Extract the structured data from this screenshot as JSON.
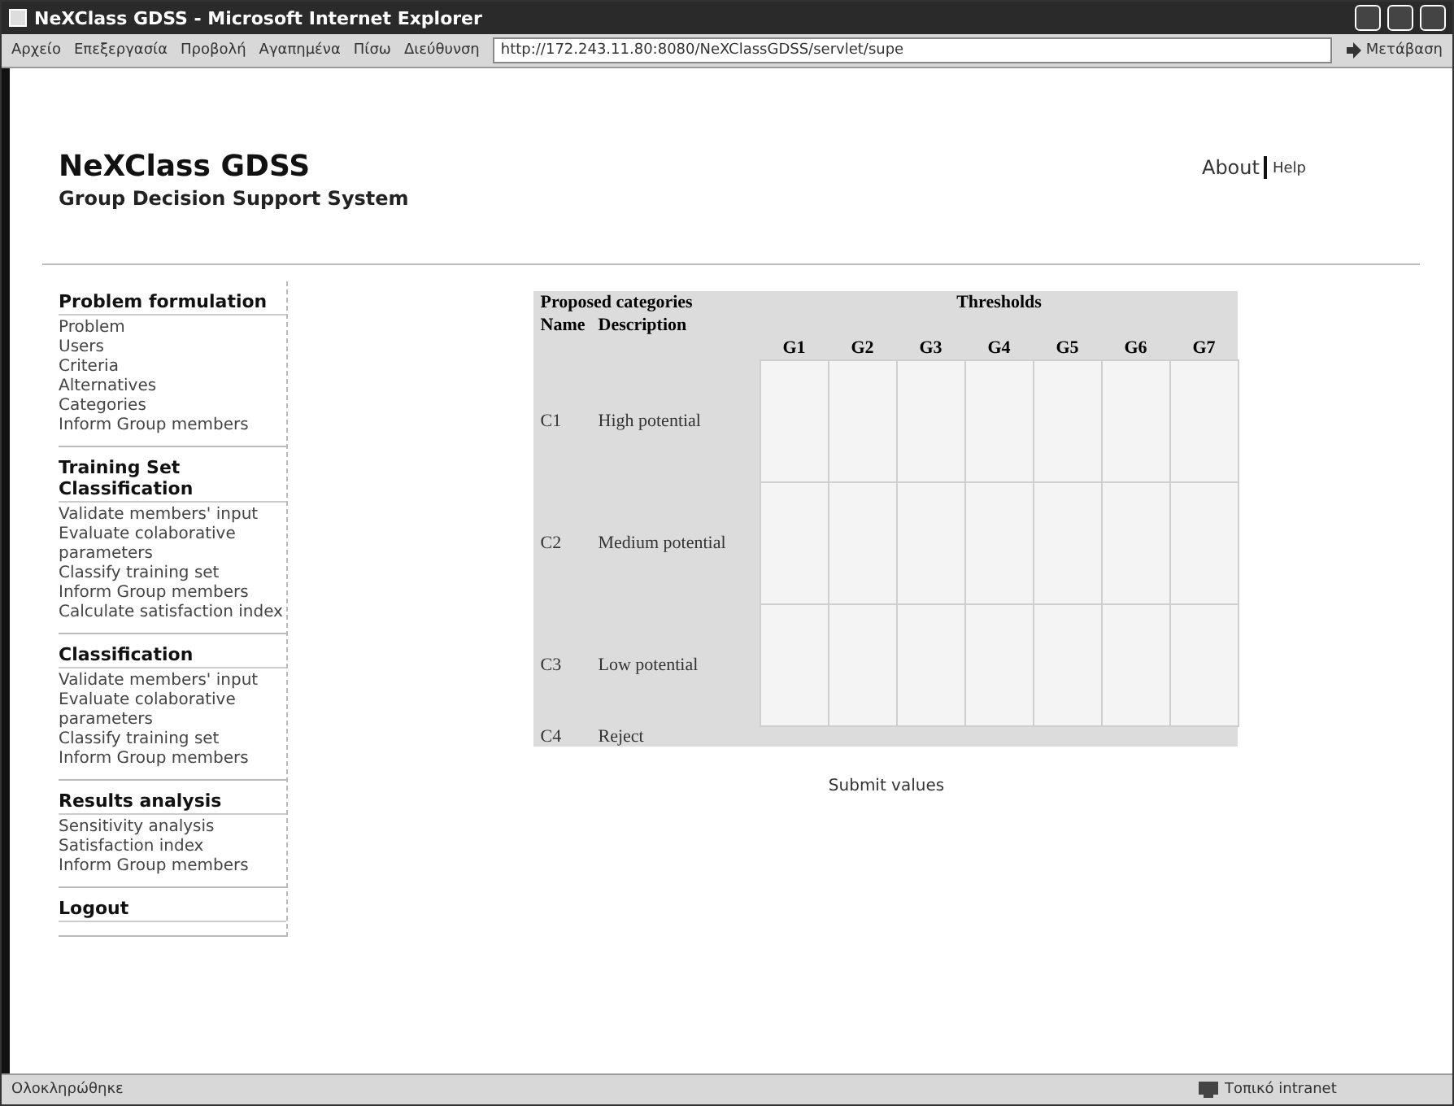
{
  "window": {
    "title": "NeXClass GDSS - Microsoft Internet Explorer"
  },
  "menu": [
    "Αρχείο",
    "Επεξεργασία",
    "Προβολή",
    "Αγαπημένα"
  ],
  "toolbar": {
    "back": "Πίσω",
    "address_label": "Διεύθυνση",
    "address": "http://172.243.11.80:8080/NeXClassGDSS/servlet/supe",
    "go": "Μετάβαση"
  },
  "header": {
    "title": "NeXClass GDSS",
    "subtitle": "Group Decision Support System",
    "links": [
      "About",
      "Help"
    ]
  },
  "sidebar": [
    {
      "title": "Problem formulation",
      "items": [
        "Problem",
        "Users",
        "Criteria",
        "Alternatives",
        "Categories",
        "Inform Group members"
      ]
    },
    {
      "title": "Training Set Classification",
      "items": [
        "Validate members' input",
        "Evaluate colaborative parameters",
        "Classify training set",
        "Inform Group members",
        "Calculate satisfaction index"
      ]
    },
    {
      "title": "Classification",
      "items": [
        "Validate members' input",
        "Evaluate colaborative parameters",
        "Classify training set",
        "Inform Group members"
      ]
    },
    {
      "title": "Results analysis",
      "items": [
        "Sensitivity analysis",
        "Satisfaction index",
        "Inform Group members"
      ]
    },
    {
      "title": "Logout"
    }
  ],
  "table": {
    "group_headers": [
      "Proposed categories",
      "Thresholds"
    ],
    "columns": [
      "Name",
      "Description"
    ],
    "criteria": [
      "G1",
      "G2",
      "G3",
      "G4",
      "G5",
      "G6",
      "G7"
    ],
    "rows": [
      {
        "name": "C1",
        "description": "High potential"
      },
      {
        "name": "C2",
        "description": "Medium potential"
      },
      {
        "name": "C3",
        "description": "Low potential"
      },
      {
        "name": "C4",
        "description": "Reject"
      }
    ]
  },
  "submit": "Submit values",
  "status_bar": {
    "status": "Ολοκληρώθηκε",
    "zone": "Τοπικό intranet"
  }
}
